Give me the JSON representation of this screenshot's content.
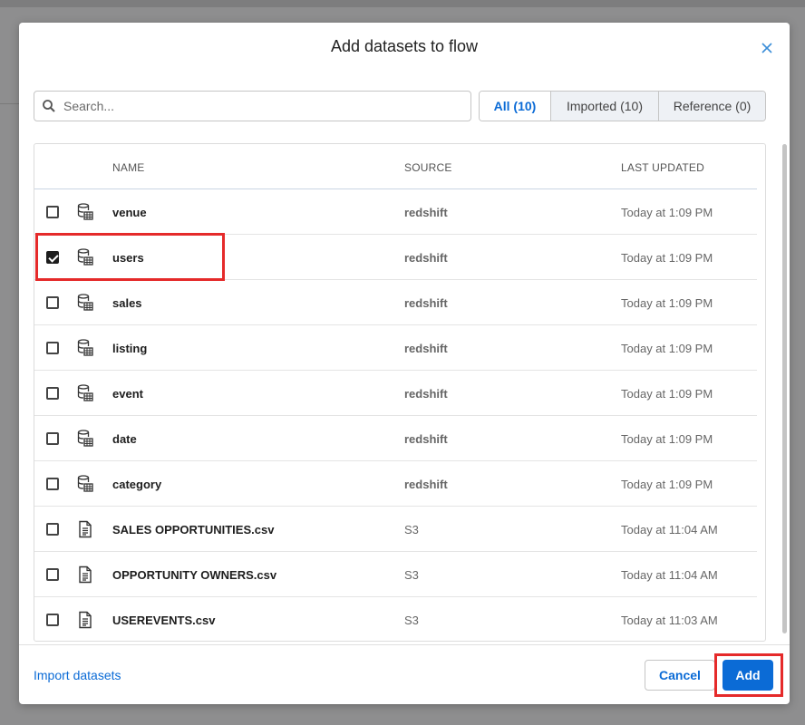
{
  "modal": {
    "title": "Add datasets to flow",
    "close_icon": "close-icon"
  },
  "search": {
    "placeholder": "Search...",
    "value": ""
  },
  "filters": [
    {
      "label": "All (10)",
      "active": true
    },
    {
      "label": "Imported (10)",
      "active": false
    },
    {
      "label": "Reference (0)",
      "active": false
    }
  ],
  "table": {
    "columns": {
      "name": "NAME",
      "source": "SOURCE",
      "updated": "LAST UPDATED"
    },
    "rows": [
      {
        "name": "venue",
        "source": "redshift",
        "updated": "Today at 1:09 PM",
        "icon": "database-table-icon",
        "checked": false
      },
      {
        "name": "users",
        "source": "redshift",
        "updated": "Today at 1:09 PM",
        "icon": "database-table-icon",
        "checked": true
      },
      {
        "name": "sales",
        "source": "redshift",
        "updated": "Today at 1:09 PM",
        "icon": "database-table-icon",
        "checked": false
      },
      {
        "name": "listing",
        "source": "redshift",
        "updated": "Today at 1:09 PM",
        "icon": "database-table-icon",
        "checked": false
      },
      {
        "name": "event",
        "source": "redshift",
        "updated": "Today at 1:09 PM",
        "icon": "database-table-icon",
        "checked": false
      },
      {
        "name": "date",
        "source": "redshift",
        "updated": "Today at 1:09 PM",
        "icon": "database-table-icon",
        "checked": false
      },
      {
        "name": "category",
        "source": "redshift",
        "updated": "Today at 1:09 PM",
        "icon": "database-table-icon",
        "checked": false
      },
      {
        "name": "SALES OPPORTUNITIES.csv",
        "source": "S3",
        "updated": "Today at 11:04 AM",
        "icon": "file-document-icon",
        "checked": false
      },
      {
        "name": "OPPORTUNITY OWNERS.csv",
        "source": "S3",
        "updated": "Today at 11:04 AM",
        "icon": "file-document-icon",
        "checked": false
      },
      {
        "name": "USEREVENTS.csv",
        "source": "S3",
        "updated": "Today at 11:03 AM",
        "icon": "file-document-icon",
        "checked": false
      }
    ]
  },
  "footer": {
    "import_link": "Import datasets",
    "cancel_label": "Cancel",
    "add_label": "Add"
  },
  "colors": {
    "accent": "#0b6bd6",
    "highlight": "#e52a2a"
  }
}
